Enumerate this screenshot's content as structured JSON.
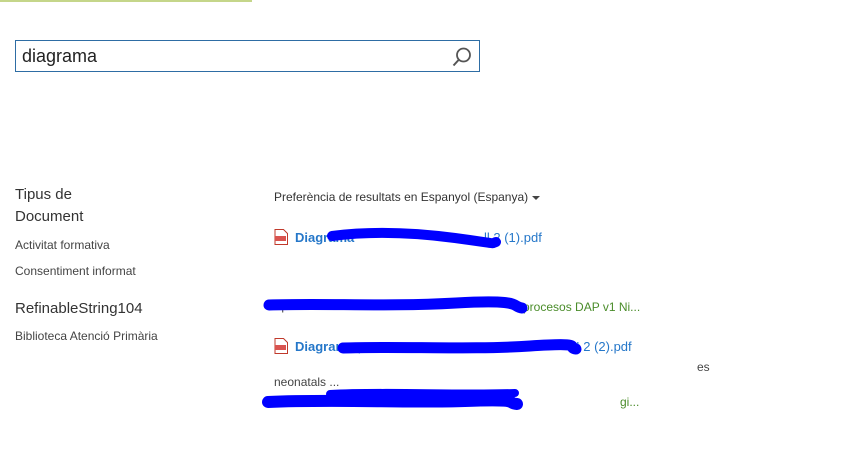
{
  "search": {
    "value": "diagrama"
  },
  "refiners": {
    "group1_title_line1": "Tipus de",
    "group1_title_line2": "Document",
    "group1_items": [
      "Activitat formativa",
      "Consentiment informat"
    ],
    "group2_title": "RefinableString104",
    "group2_items": [
      "Biblioteca Atenció Primària"
    ]
  },
  "results": {
    "preference_label": "Preferència de resultats en Espanyol (Espanya)",
    "items": [
      {
        "title_bold": "Diagrama",
        "title_rest": "ll 2 (1).pdf",
        "url_text": "https://xxxxxxxxx/Di",
        "url_tail": "procesos DAP v1 Ni...",
        "snippet": ""
      },
      {
        "title_bold": "Diagrama",
        "title_rest": " processos est",
        "title_tail": "I 2 (2).pdf",
        "snippet_side": "es",
        "snippet": "neonatals ...",
        "url_tail": "gi..."
      }
    ]
  },
  "colors": {
    "accent": "#2e6da4",
    "link": "#2577c9",
    "url_green": "#4a8c2a",
    "redaction": "#0000ff"
  }
}
